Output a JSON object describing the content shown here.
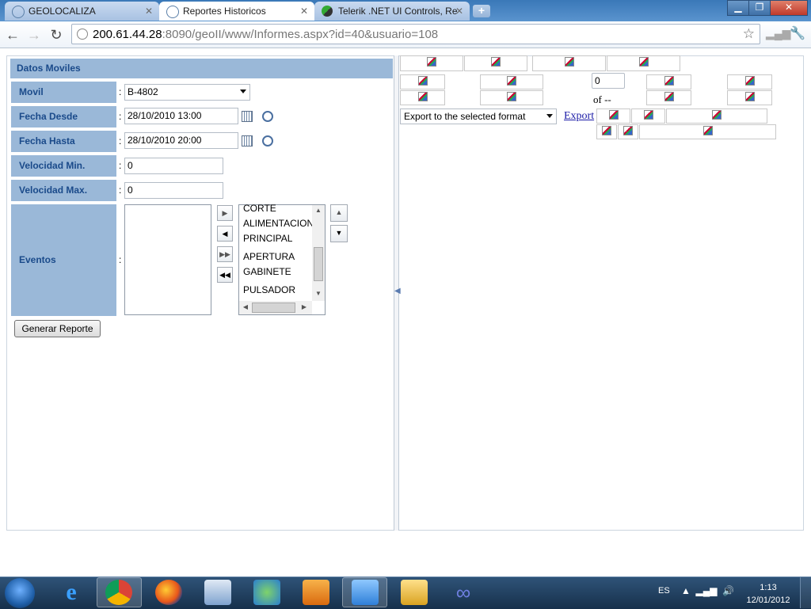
{
  "browser": {
    "tabs": [
      {
        "label": "GEOLOCALIZA"
      },
      {
        "label": "Reportes Historicos"
      },
      {
        "label": "Telerik .NET UI Controls, Re"
      }
    ],
    "url_host": "200.61.44.28",
    "url_rest": ":8090/geoII/www/Informes.aspx?id=40&usuario=108"
  },
  "form": {
    "header": "Datos Moviles",
    "movil_label": "Movil",
    "movil_value": "B-4802",
    "fecha_desde_label": "Fecha Desde",
    "fecha_desde_value": "28/10/2010 13:00",
    "fecha_hasta_label": "Fecha Hasta",
    "fecha_hasta_value": "28/10/2010 20:00",
    "vel_min_label": "Velocidad Min.",
    "vel_min_value": "0",
    "vel_max_label": "Velocidad Max.",
    "vel_max_value": "0",
    "eventos_label": "Eventos",
    "colon": ":",
    "event_items": [
      "CORTE",
      "ALIMENTACION",
      "PRINCIPAL",
      "APERTURA",
      "GABINETE",
      "PULSADOR"
    ],
    "generate_label": "Generar Reporte"
  },
  "report": {
    "page_value": "0",
    "of_text": "of --",
    "export_format": "Export to the selected format",
    "export_link": "Export"
  },
  "taskbar": {
    "lang": "ES",
    "time": "1:13",
    "date": "12/01/2012"
  },
  "colors": {
    "label_bg": "#9ab8d8",
    "label_text": "#1a4a8a"
  }
}
